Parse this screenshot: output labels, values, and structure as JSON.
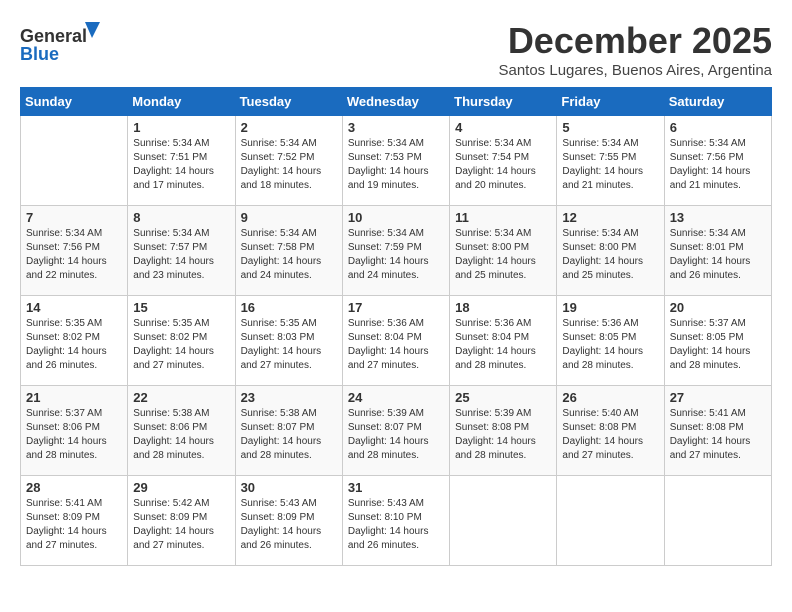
{
  "logo": {
    "text1": "General",
    "text2": "Blue"
  },
  "title": "December 2025",
  "location": "Santos Lugares, Buenos Aires, Argentina",
  "days_header": [
    "Sunday",
    "Monday",
    "Tuesday",
    "Wednesday",
    "Thursday",
    "Friday",
    "Saturday"
  ],
  "weeks": [
    [
      {
        "num": "",
        "info": ""
      },
      {
        "num": "1",
        "info": "Sunrise: 5:34 AM\nSunset: 7:51 PM\nDaylight: 14 hours\nand 17 minutes."
      },
      {
        "num": "2",
        "info": "Sunrise: 5:34 AM\nSunset: 7:52 PM\nDaylight: 14 hours\nand 18 minutes."
      },
      {
        "num": "3",
        "info": "Sunrise: 5:34 AM\nSunset: 7:53 PM\nDaylight: 14 hours\nand 19 minutes."
      },
      {
        "num": "4",
        "info": "Sunrise: 5:34 AM\nSunset: 7:54 PM\nDaylight: 14 hours\nand 20 minutes."
      },
      {
        "num": "5",
        "info": "Sunrise: 5:34 AM\nSunset: 7:55 PM\nDaylight: 14 hours\nand 21 minutes."
      },
      {
        "num": "6",
        "info": "Sunrise: 5:34 AM\nSunset: 7:56 PM\nDaylight: 14 hours\nand 21 minutes."
      }
    ],
    [
      {
        "num": "7",
        "info": "Sunrise: 5:34 AM\nSunset: 7:56 PM\nDaylight: 14 hours\nand 22 minutes."
      },
      {
        "num": "8",
        "info": "Sunrise: 5:34 AM\nSunset: 7:57 PM\nDaylight: 14 hours\nand 23 minutes."
      },
      {
        "num": "9",
        "info": "Sunrise: 5:34 AM\nSunset: 7:58 PM\nDaylight: 14 hours\nand 24 minutes."
      },
      {
        "num": "10",
        "info": "Sunrise: 5:34 AM\nSunset: 7:59 PM\nDaylight: 14 hours\nand 24 minutes."
      },
      {
        "num": "11",
        "info": "Sunrise: 5:34 AM\nSunset: 8:00 PM\nDaylight: 14 hours\nand 25 minutes."
      },
      {
        "num": "12",
        "info": "Sunrise: 5:34 AM\nSunset: 8:00 PM\nDaylight: 14 hours\nand 25 minutes."
      },
      {
        "num": "13",
        "info": "Sunrise: 5:34 AM\nSunset: 8:01 PM\nDaylight: 14 hours\nand 26 minutes."
      }
    ],
    [
      {
        "num": "14",
        "info": "Sunrise: 5:35 AM\nSunset: 8:02 PM\nDaylight: 14 hours\nand 26 minutes."
      },
      {
        "num": "15",
        "info": "Sunrise: 5:35 AM\nSunset: 8:02 PM\nDaylight: 14 hours\nand 27 minutes."
      },
      {
        "num": "16",
        "info": "Sunrise: 5:35 AM\nSunset: 8:03 PM\nDaylight: 14 hours\nand 27 minutes."
      },
      {
        "num": "17",
        "info": "Sunrise: 5:36 AM\nSunset: 8:04 PM\nDaylight: 14 hours\nand 27 minutes."
      },
      {
        "num": "18",
        "info": "Sunrise: 5:36 AM\nSunset: 8:04 PM\nDaylight: 14 hours\nand 28 minutes."
      },
      {
        "num": "19",
        "info": "Sunrise: 5:36 AM\nSunset: 8:05 PM\nDaylight: 14 hours\nand 28 minutes."
      },
      {
        "num": "20",
        "info": "Sunrise: 5:37 AM\nSunset: 8:05 PM\nDaylight: 14 hours\nand 28 minutes."
      }
    ],
    [
      {
        "num": "21",
        "info": "Sunrise: 5:37 AM\nSunset: 8:06 PM\nDaylight: 14 hours\nand 28 minutes."
      },
      {
        "num": "22",
        "info": "Sunrise: 5:38 AM\nSunset: 8:06 PM\nDaylight: 14 hours\nand 28 minutes."
      },
      {
        "num": "23",
        "info": "Sunrise: 5:38 AM\nSunset: 8:07 PM\nDaylight: 14 hours\nand 28 minutes."
      },
      {
        "num": "24",
        "info": "Sunrise: 5:39 AM\nSunset: 8:07 PM\nDaylight: 14 hours\nand 28 minutes."
      },
      {
        "num": "25",
        "info": "Sunrise: 5:39 AM\nSunset: 8:08 PM\nDaylight: 14 hours\nand 28 minutes."
      },
      {
        "num": "26",
        "info": "Sunrise: 5:40 AM\nSunset: 8:08 PM\nDaylight: 14 hours\nand 27 minutes."
      },
      {
        "num": "27",
        "info": "Sunrise: 5:41 AM\nSunset: 8:08 PM\nDaylight: 14 hours\nand 27 minutes."
      }
    ],
    [
      {
        "num": "28",
        "info": "Sunrise: 5:41 AM\nSunset: 8:09 PM\nDaylight: 14 hours\nand 27 minutes."
      },
      {
        "num": "29",
        "info": "Sunrise: 5:42 AM\nSunset: 8:09 PM\nDaylight: 14 hours\nand 27 minutes."
      },
      {
        "num": "30",
        "info": "Sunrise: 5:43 AM\nSunset: 8:09 PM\nDaylight: 14 hours\nand 26 minutes."
      },
      {
        "num": "31",
        "info": "Sunrise: 5:43 AM\nSunset: 8:10 PM\nDaylight: 14 hours\nand 26 minutes."
      },
      {
        "num": "",
        "info": ""
      },
      {
        "num": "",
        "info": ""
      },
      {
        "num": "",
        "info": ""
      }
    ]
  ]
}
